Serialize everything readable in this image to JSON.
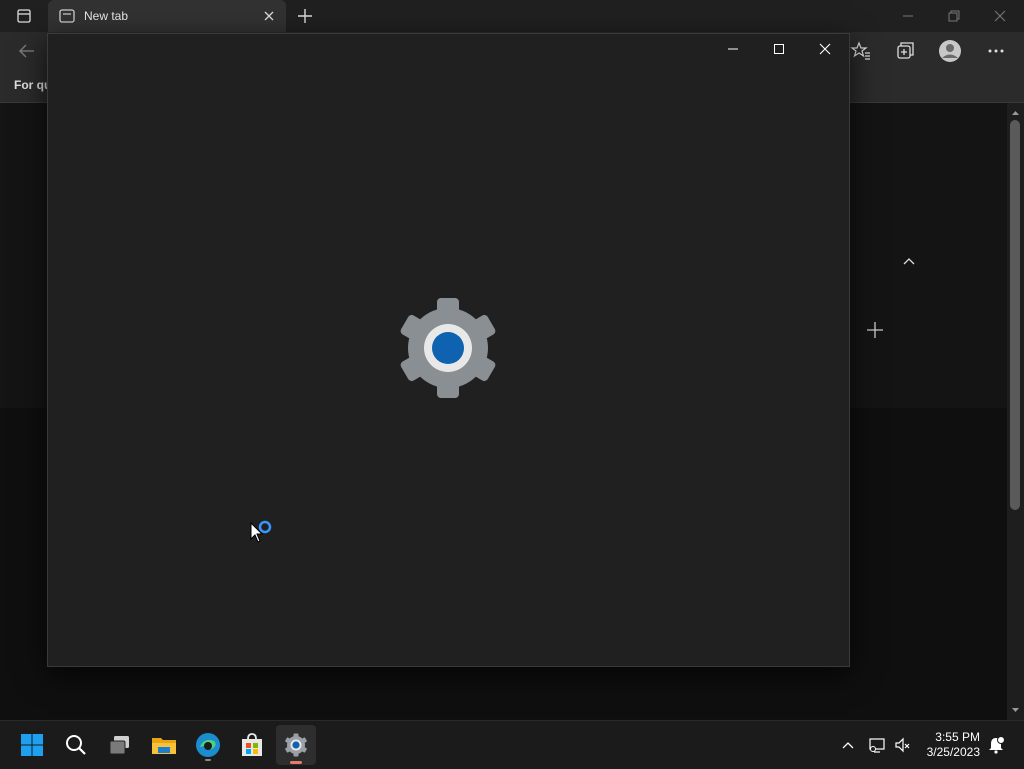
{
  "browser": {
    "tab_title": "New tab",
    "favorites_label": "For qu"
  },
  "taskbar": {
    "time": "3:55 PM",
    "date": "3/25/2023"
  },
  "colors": {
    "settings_window_bg": "#202020",
    "gear_gray": "#8a8f94",
    "gear_blue": "#0f62b0",
    "spinner_blue": "#3a95ff",
    "taskbar_bg": "#1b1b1b"
  },
  "icons": [
    "browser-sidebar-icon",
    "tab-favicon-icon",
    "close-tab-icon",
    "new-tab-icon",
    "back-icon",
    "favorites-star-icon",
    "collections-icon",
    "profile-icon",
    "more-options-icon",
    "settings-gear-icon",
    "loading-spinner-icon",
    "mouse-pointer-icon",
    "windows-start-icon",
    "search-icon",
    "task-view-icon",
    "file-explorer-icon",
    "edge-icon",
    "store-icon",
    "settings-taskbar-icon",
    "show-hidden-icons-icon",
    "network-icon",
    "volume-muted-icon",
    "notification-icon"
  ]
}
